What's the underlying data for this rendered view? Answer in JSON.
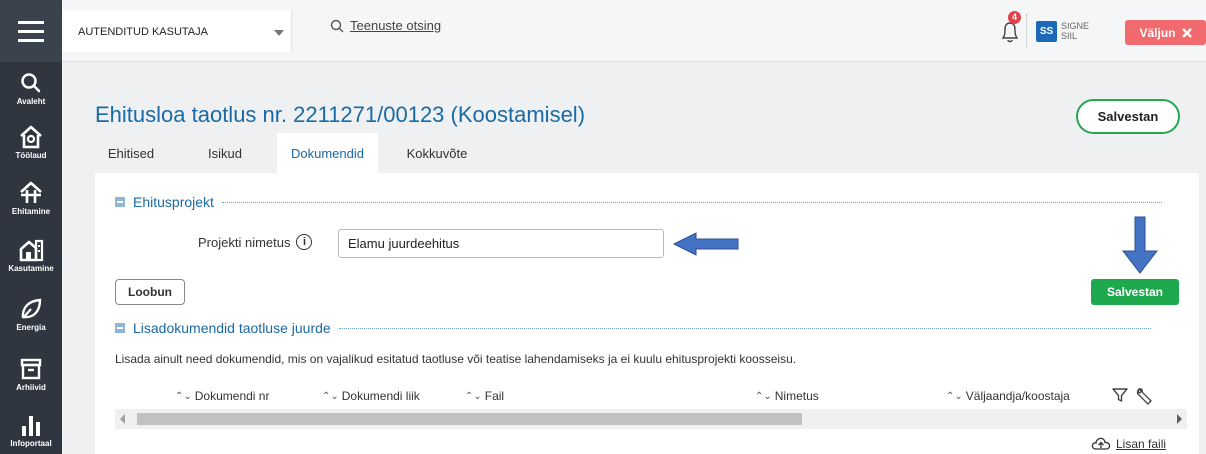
{
  "nav": {
    "items": [
      {
        "label": "Avaleht",
        "icon": "search-icon"
      },
      {
        "label": "Töölaud",
        "icon": "home-icon"
      },
      {
        "label": "Ehitamine",
        "icon": "construction-icon"
      },
      {
        "label": "Kasutamine",
        "icon": "building-icon"
      },
      {
        "label": "Energia",
        "icon": "leaf-icon"
      },
      {
        "label": "Arhiivid",
        "icon": "archive-icon"
      },
      {
        "label": "Infoportaal",
        "icon": "bar-chart-icon"
      }
    ]
  },
  "topbar": {
    "role": "AUTENDITUD KASUTAJA",
    "search_label": "Teenuste otsing",
    "notification_count": "4",
    "user_initials": "SS",
    "user_first": "SIGNE",
    "user_last": "SIIL",
    "logout_label": "Väljun"
  },
  "page": {
    "title": "Ehitusloa taotlus nr. 2211271/00123 (Koostamisel)",
    "save_label": "Salvestan",
    "tabs": [
      {
        "label": "Ehitised",
        "active": false
      },
      {
        "label": "Isikud",
        "active": false
      },
      {
        "label": "Dokumendid",
        "active": true
      },
      {
        "label": "Kokkuvõte",
        "active": false
      }
    ]
  },
  "project": {
    "section_title": "Ehitusprojekt",
    "field_label": "Projekti nimetus",
    "field_value": "Elamu juurdeehitus",
    "cancel_label": "Loobun",
    "save_label": "Salvestan"
  },
  "extra_docs": {
    "section_title": "Lisadokumendid taotluse juurde",
    "note": "Lisada ainult need dokumendid, mis on vajalikud esitatud taotluse või teatise lahendamiseks ja ei kuulu ehitusprojekti koosseisu.",
    "columns": [
      "Dokumendi nr",
      "Dokumendi liik",
      "Fail",
      "Nimetus",
      "Väljaandja/koostaja"
    ],
    "upload_label": "Lisan faili"
  },
  "colors": {
    "accent_blue": "#1a6aa5",
    "green": "#1ea94e",
    "logout_red": "#f06a6e",
    "annotation_arrow": "#4472c4"
  }
}
